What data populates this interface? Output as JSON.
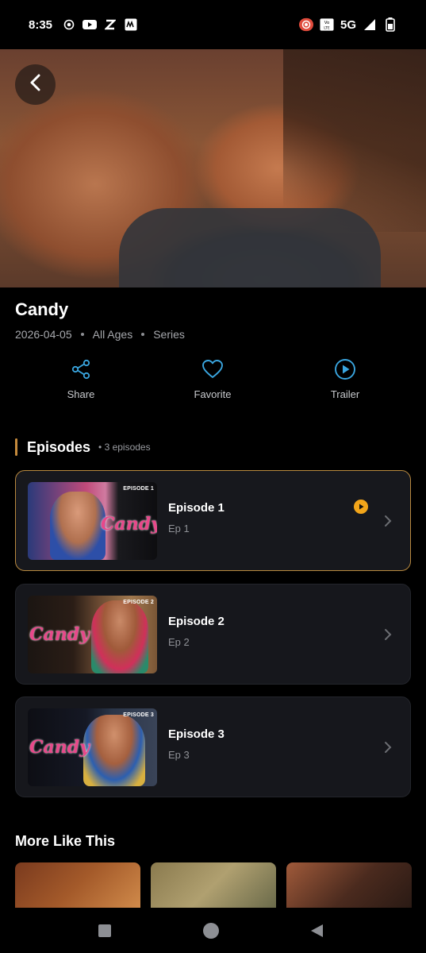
{
  "status_bar": {
    "time": "8:35",
    "network": "5G",
    "left_icons": [
      "record-icon",
      "youtube-icon",
      "z-icon",
      "my-app-icon"
    ],
    "right_icons": [
      "screen-record-icon",
      "volte-icon",
      "signal-icon",
      "battery-icon"
    ]
  },
  "hero": {
    "back_icon": "chevron-left-icon"
  },
  "show": {
    "title": "Candy",
    "date": "2026-04-05",
    "rating": "All Ages",
    "type": "Series"
  },
  "actions": [
    {
      "label": "Share",
      "icon": "share-icon"
    },
    {
      "label": "Favorite",
      "icon": "heart-icon"
    },
    {
      "label": "Trailer",
      "icon": "play-circle-icon"
    }
  ],
  "episodes_section": {
    "title": "Episodes",
    "count": "• 3 episodes",
    "items": [
      {
        "name": "Episode 1",
        "sub": "Ep 1",
        "tag": "EPISODE 1",
        "logo": "Candy",
        "active": true
      },
      {
        "name": "Episode 2",
        "sub": "Ep 2",
        "tag": "EPISODE 2",
        "logo": "Candy",
        "active": false
      },
      {
        "name": "Episode 3",
        "sub": "Ep 3",
        "tag": "EPISODE 3",
        "logo": "Candy",
        "active": false
      }
    ]
  },
  "more_like_this": {
    "title": "More Like This"
  },
  "colors": {
    "accent": "#c58a3c",
    "play_badge": "#f2a51a",
    "action_icon": "#3aa6e0",
    "card_bg": "#16171c"
  },
  "nav_bar": {
    "icons": [
      "recents-square-icon",
      "home-circle-icon",
      "back-triangle-icon"
    ]
  }
}
